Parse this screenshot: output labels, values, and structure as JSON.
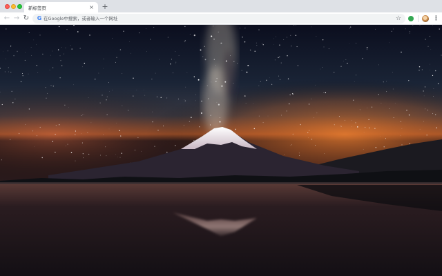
{
  "browser": {
    "tab": {
      "title": "新标签页"
    },
    "new_tab_symbol": "+",
    "close_symbol": "×",
    "nav": {
      "back": "←",
      "forward": "→",
      "reload": "↻"
    },
    "omnibox": {
      "placeholder": "在Google中搜索，或者输入一个网址",
      "engine_letter": "G"
    },
    "star": "☆",
    "menu": "⋮"
  },
  "wallpaper": {
    "subject": "mount-fuji-milky-way-night-lake-reflection",
    "colors": {
      "sky_top": "#0a0d1c",
      "sky_mid": "#1b2436",
      "horizon_glow": "#d36a2c",
      "snow": "#f2f0f3",
      "mountain": "#2a2230",
      "water": "#1a1418"
    }
  }
}
